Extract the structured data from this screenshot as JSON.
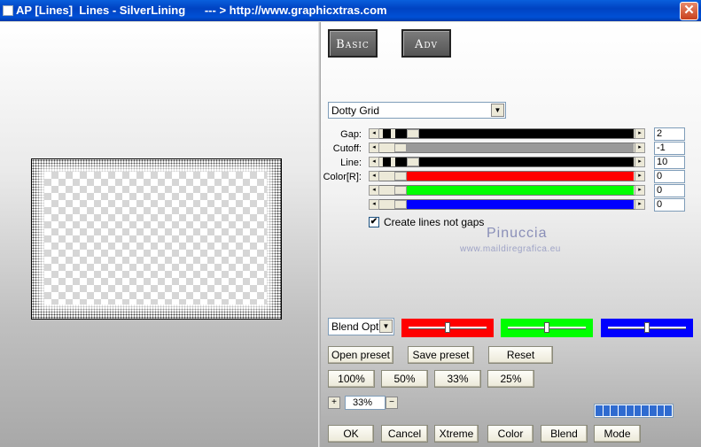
{
  "window": {
    "title": "AP [Lines]  Lines - SilverLining      --- > http://www.graphicxtras.com",
    "close_glyph": "✕"
  },
  "tabs": {
    "basic": "Basic",
    "adv": "Adv"
  },
  "pattern_select": {
    "value": "Dotty Grid",
    "arrow": "▼"
  },
  "sliders": [
    {
      "label": "Gap:",
      "value": "2",
      "color": "#000000",
      "level": 0.05
    },
    {
      "label": "Cutoff:",
      "value": "-1",
      "color": "#9a9a9a",
      "level": 0.0
    },
    {
      "label": "Line:",
      "value": "10",
      "color": "#000000",
      "level": 0.05
    },
    {
      "label": "Color[R]:",
      "value": "0",
      "color": "#ff0000",
      "level": 0.0
    },
    {
      "label": "",
      "value": "0",
      "color": "#00ff00",
      "level": 0.0
    },
    {
      "label": "",
      "value": "0",
      "color": "#0000ff",
      "level": 0.0
    }
  ],
  "arrows": {
    "left": "◂",
    "right": "▸"
  },
  "checkbox": {
    "label": "Create lines not gaps",
    "checked": true,
    "mark": "✔"
  },
  "watermark": {
    "line1": "Pinuccia",
    "line2": "www.maildiregrafica.eu"
  },
  "blend_select": {
    "value": "Blend Optio",
    "arrow": "▼"
  },
  "color_boxes": [
    {
      "color": "#ff0000",
      "level": 0.5
    },
    {
      "color": "#00ff00",
      "level": 0.5
    },
    {
      "color": "#0000ff",
      "level": 0.5
    }
  ],
  "preset_buttons": {
    "open": "Open preset",
    "save": "Save preset",
    "reset": "Reset"
  },
  "zoom_buttons": [
    "100%",
    "50%",
    "33%",
    "25%"
  ],
  "zoom": {
    "plus": "+",
    "value": "33%",
    "minus": "−"
  },
  "progress": {
    "level": 1.0
  },
  "bottom_buttons": [
    "OK",
    "Cancel",
    "Xtreme",
    "Color",
    "Blend",
    "Mode"
  ]
}
